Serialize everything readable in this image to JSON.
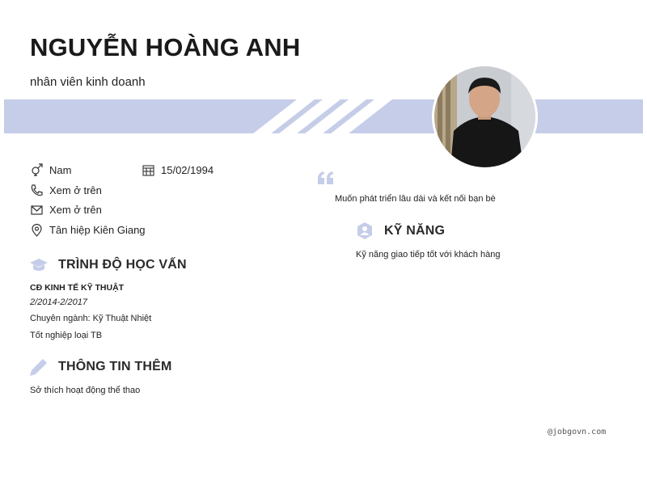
{
  "header": {
    "name": "NGUYỄN HOÀNG ANH",
    "job_title": "nhân viên kinh doanh"
  },
  "contact": {
    "gender": "Nam",
    "birthday": "15/02/1994",
    "phone": "Xem ở trên",
    "email": "Xem ở trên",
    "address": "Tân hiệp Kiên Giang"
  },
  "education": {
    "heading": "TRÌNH ĐỘ HỌC VẤN",
    "school": "CĐ KINH TẾ KỸ THUẬT",
    "period": "2/2014-2/2017",
    "major": "Chuyên ngành: Kỹ Thuật Nhiệt",
    "grade": "Tốt nghiệp loại TB"
  },
  "additional": {
    "heading": "THÔNG TIN THÊM",
    "text": "Sở thích hoạt động thể thao"
  },
  "objective": {
    "text": "Muốn phát triển lâu dài và kết nối bạn bè"
  },
  "skills": {
    "heading": "KỸ NĂNG",
    "text": "Kỹ năng giao tiếp tốt với khách hàng"
  },
  "watermark": "@jobgovn.com",
  "colors": {
    "accent": "#c5cde8",
    "text": "#1f1f1f"
  },
  "icons": [
    "gender-icon",
    "calendar-icon",
    "phone-icon",
    "email-icon",
    "location-icon",
    "graduation-cap-icon",
    "pencil-icon",
    "quote-icon",
    "skills-badge-icon"
  ]
}
